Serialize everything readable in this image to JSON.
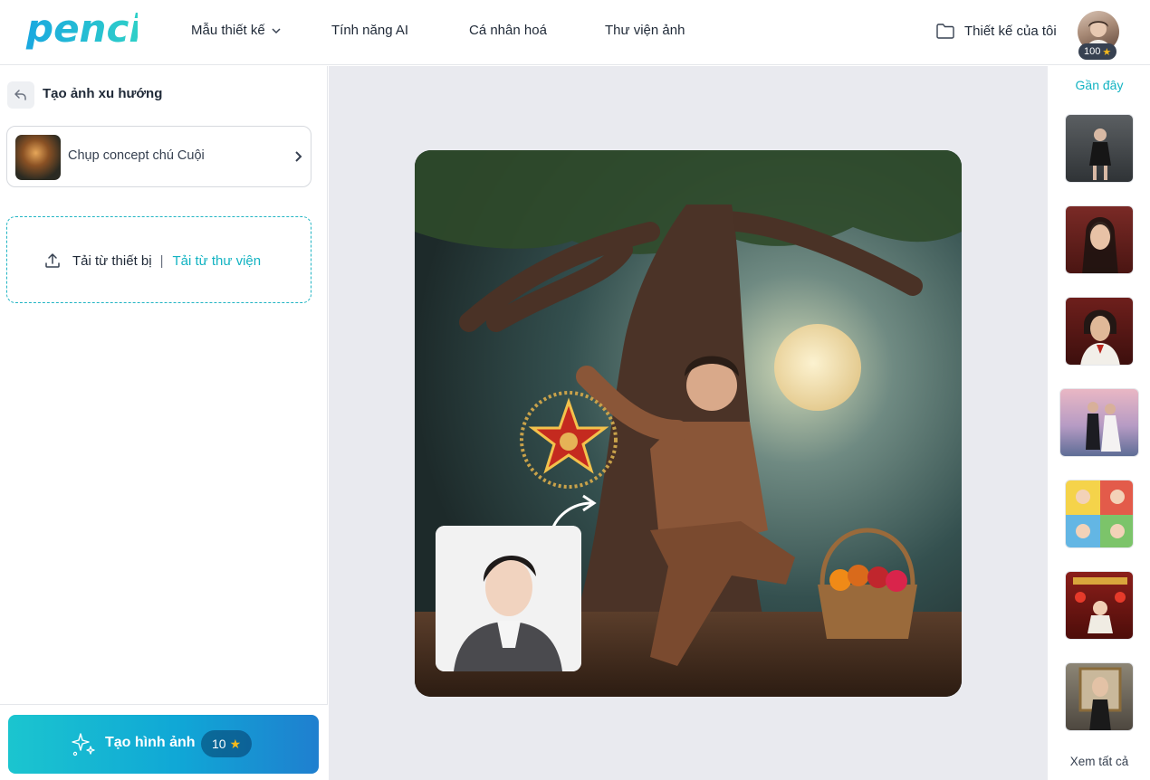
{
  "brand": {
    "logo_text": "penci",
    "accent": "#13b3c2"
  },
  "nav": {
    "items": [
      {
        "label": "Mẫu thiết kế",
        "has_dropdown": true
      },
      {
        "label": "Tính năng AI"
      },
      {
        "label": "Cá nhân hoá"
      },
      {
        "label": "Thư viện ảnh"
      }
    ],
    "my_designs": "Thiết kế của tôi",
    "user_points": "100"
  },
  "left_panel": {
    "title": "Tạo ảnh xu hướng",
    "concept": {
      "label": "Chụp concept chú Cuội"
    },
    "upload": {
      "device_label": "Tải từ thiết bị",
      "separator": "|",
      "library_label": "Tải từ thư viện"
    },
    "generate": {
      "label": "Tạo hình ảnh",
      "cost": "10"
    }
  },
  "right_panel": {
    "recent_label": "Gần đây",
    "see_all": "Xem tất cả",
    "thumbnails": [
      {
        "icon": "elevator-portrait-thumb"
      },
      {
        "icon": "woman-red-portrait-thumb"
      },
      {
        "icon": "woman-ao-dai-thumb"
      },
      {
        "icon": "couple-beach-thumb"
      },
      {
        "icon": "baby-collage-thumb"
      },
      {
        "icon": "tet-family-thumb"
      },
      {
        "icon": "gallery-woman-thumb"
      }
    ]
  }
}
